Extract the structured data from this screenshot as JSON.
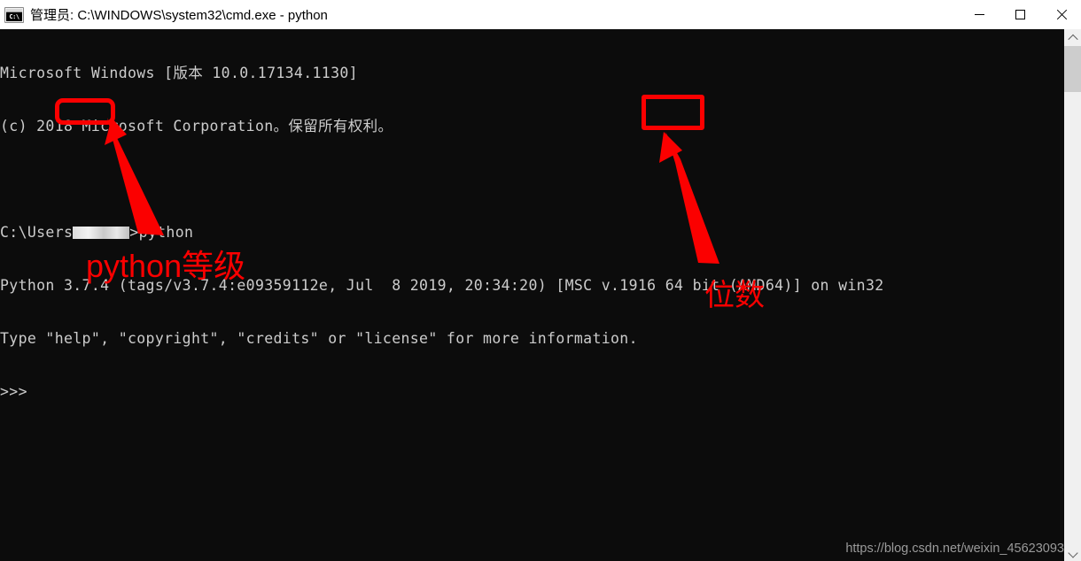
{
  "window": {
    "title": "管理员: C:\\WINDOWS\\system32\\cmd.exe - python",
    "icon": "cmd-console-icon",
    "icon_glyph": "C:\\",
    "controls": {
      "minimize": "minimize-button",
      "maximize": "maximize-button",
      "close": "close-button"
    }
  },
  "console": {
    "lines": [
      {
        "id": "line-version-banner",
        "text": "Microsoft Windows [版本 10.0.17134.1130]"
      },
      {
        "id": "line-copyright",
        "text": "(c) 2018 Microsoft Corporation。保留所有权利。"
      },
      {
        "id": "line-blank-1",
        "text": ""
      },
      {
        "id": "line-prompt-command",
        "pre": "C:\\Users",
        "redacted": true,
        "post": ">python"
      },
      {
        "id": "line-python-banner",
        "text": "Python 3.7.4 (tags/v3.7.4:e09359112e, Jul  8 2019, 20:34:20) [MSC v.1916 64 bit (AMD64)] on win32"
      },
      {
        "id": "line-python-help",
        "text": "Type \"help\", \"copyright\", \"credits\" or \"license\" for more information."
      },
      {
        "id": "line-python-prompt",
        "text": ">>>"
      }
    ],
    "background_color": "#0c0c0c",
    "text_color": "#cccccc"
  },
  "annotations": {
    "accent_color": "#fb0000",
    "boxes": [
      {
        "id": "box-version",
        "targets": "3.7.4"
      },
      {
        "id": "box-bits",
        "targets": "64 bit"
      }
    ],
    "labels": [
      {
        "id": "label-version",
        "text": "python等级"
      },
      {
        "id": "label-bits",
        "text": "位数"
      }
    ]
  },
  "scrollbar": {
    "up_arrow": "scroll-up-arrow",
    "down_arrow": "scroll-down-arrow",
    "thumb": "scroll-thumb"
  },
  "watermark": {
    "text": "https://blog.csdn.net/weixin_45623093"
  }
}
